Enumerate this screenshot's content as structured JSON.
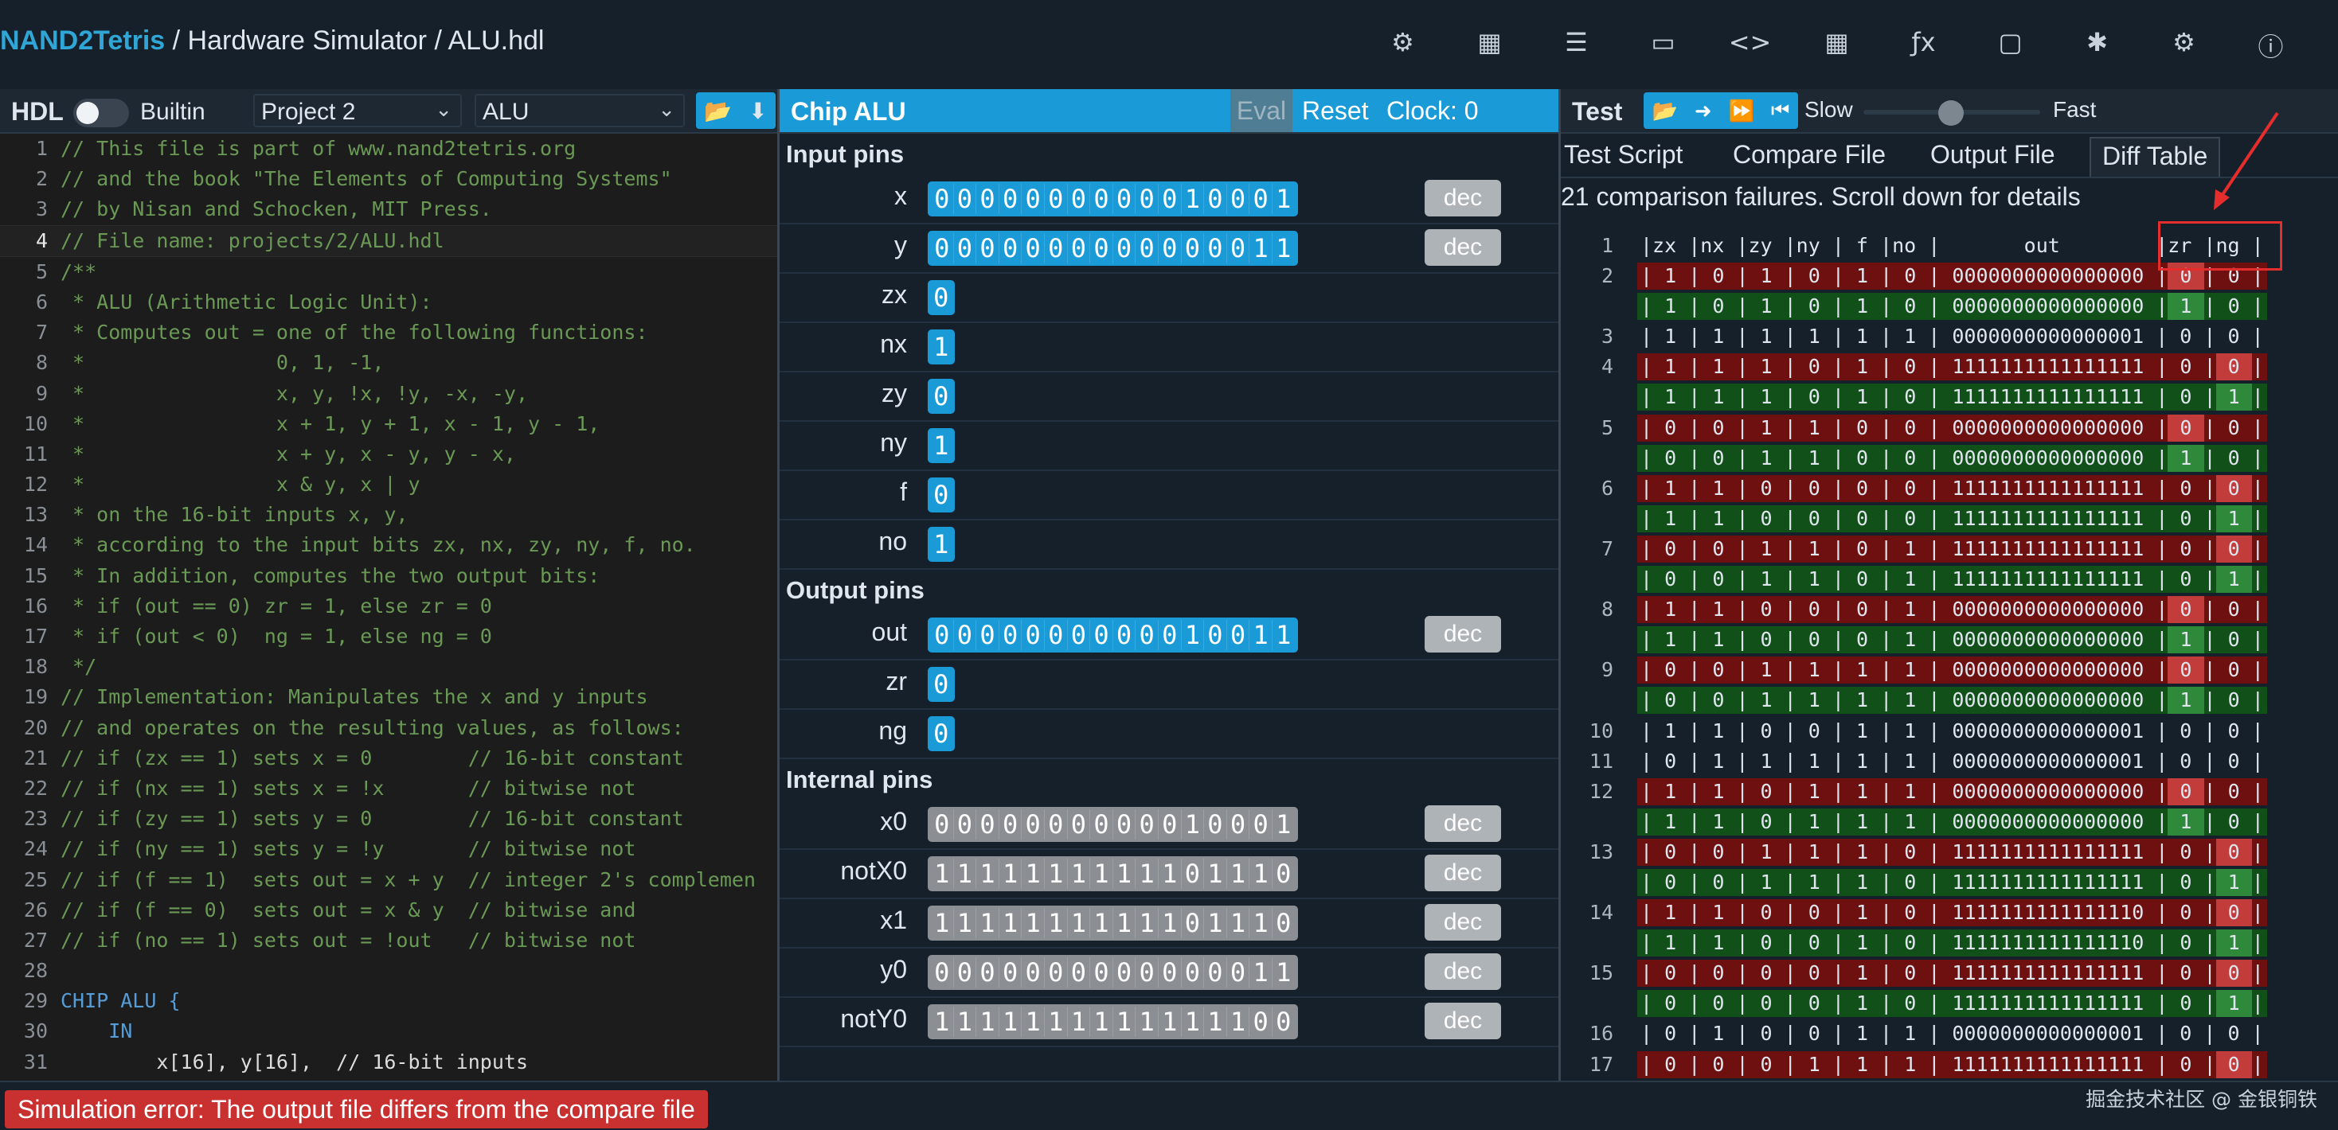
{
  "header": {
    "brand": "NAND2Tetris",
    "breadcrumb_sep1": "/",
    "breadcrumb_section": "Hardware Simulator",
    "breadcrumb_sep2": "/",
    "breadcrumb_file": "ALU.hdl",
    "icons": [
      "chip-icon",
      "cpu-icon",
      "list-icon",
      "monitor-icon",
      "code-icon",
      "grid-icon",
      "function-icon",
      "book-icon",
      "bug-icon",
      "settings-icon",
      "info-icon"
    ],
    "icon_glyphs": [
      "⚙",
      "▦",
      "☰",
      "▭",
      "<>",
      "▦",
      "ƒx",
      "▢",
      "✱",
      "⚙",
      "ⓘ"
    ]
  },
  "hdl_panel": {
    "title": "HDL",
    "builtin_label": "Builtin",
    "project_select": "Project 2",
    "chip_select": "ALU",
    "buttons": [
      "📂",
      "⬇"
    ],
    "lines": [
      {
        "n": "1",
        "t": "// This file is part of www.nand2tetris.org",
        "k": "ct"
      },
      {
        "n": "2",
        "t": "// and the book \"The Elements of Computing Systems\"",
        "k": "ct"
      },
      {
        "n": "3",
        "t": "// by Nisan and Schocken, MIT Press.",
        "k": "ct"
      },
      {
        "n": "4",
        "t": "// File name: projects/2/ALU.hdl",
        "k": "ct"
      },
      {
        "n": "5",
        "t": "/**",
        "k": "ct"
      },
      {
        "n": "6",
        "t": " * ALU (Arithmetic Logic Unit):",
        "k": "ct"
      },
      {
        "n": "7",
        "t": " * Computes out = one of the following functions:",
        "k": "ct"
      },
      {
        "n": "8",
        "t": " *                0, 1, -1,",
        "k": "ct"
      },
      {
        "n": "9",
        "t": " *                x, y, !x, !y, -x, -y,",
        "k": "ct"
      },
      {
        "n": "10",
        "t": " *                x + 1, y + 1, x - 1, y - 1,",
        "k": "ct"
      },
      {
        "n": "11",
        "t": " *                x + y, x - y, y - x,",
        "k": "ct"
      },
      {
        "n": "12",
        "t": " *                x & y, x | y",
        "k": "ct"
      },
      {
        "n": "13",
        "t": " * on the 16-bit inputs x, y,",
        "k": "ct"
      },
      {
        "n": "14",
        "t": " * according to the input bits zx, nx, zy, ny, f, no.",
        "k": "ct"
      },
      {
        "n": "15",
        "t": " * In addition, computes the two output bits:",
        "k": "ct"
      },
      {
        "n": "16",
        "t": " * if (out == 0) zr = 1, else zr = 0",
        "k": "ct"
      },
      {
        "n": "17",
        "t": " * if (out < 0)  ng = 1, else ng = 0",
        "k": "ct"
      },
      {
        "n": "18",
        "t": " */",
        "k": "ct"
      },
      {
        "n": "19",
        "t": "// Implementation: Manipulates the x and y inputs",
        "k": "ct"
      },
      {
        "n": "20",
        "t": "// and operates on the resulting values, as follows:",
        "k": "ct"
      },
      {
        "n": "21",
        "t": "// if (zx == 1) sets x = 0        // 16-bit constant",
        "k": "ct"
      },
      {
        "n": "22",
        "t": "// if (nx == 1) sets x = !x       // bitwise not",
        "k": "ct"
      },
      {
        "n": "23",
        "t": "// if (zy == 1) sets y = 0        // 16-bit constant",
        "k": "ct"
      },
      {
        "n": "24",
        "t": "// if (ny == 1) sets y = !y       // bitwise not",
        "k": "ct"
      },
      {
        "n": "25",
        "t": "// if (f == 1)  sets out = x + y  // integer 2's complemen",
        "k": "ct"
      },
      {
        "n": "26",
        "t": "// if (f == 0)  sets out = x & y  // bitwise and",
        "k": "ct"
      },
      {
        "n": "27",
        "t": "// if (no == 1) sets out = !out   // bitwise not",
        "k": "ct"
      },
      {
        "n": "28",
        "t": "",
        "k": "tx"
      },
      {
        "n": "29",
        "t": "CHIP ALU {",
        "k": "kw"
      },
      {
        "n": "30",
        "t": "    IN",
        "k": "kw"
      },
      {
        "n": "31",
        "t": "        x[16], y[16],  // 16-bit inputs",
        "k": "mix"
      }
    ]
  },
  "chip_panel": {
    "title": "Chip ALU",
    "eval_label": "Eval",
    "reset_label": "Reset",
    "clock_label": "Clock: 0",
    "dec_label": "dec",
    "input_section": "Input pins",
    "output_section": "Output pins",
    "internal_section": "Internal pins",
    "inputs": [
      {
        "name": "x",
        "bits": "0000000000010001"
      },
      {
        "name": "y",
        "bits": "0000000000000011"
      },
      {
        "name": "zx",
        "bits": "0"
      },
      {
        "name": "nx",
        "bits": "1"
      },
      {
        "name": "zy",
        "bits": "0"
      },
      {
        "name": "ny",
        "bits": "1"
      },
      {
        "name": "f",
        "bits": "0"
      },
      {
        "name": "no",
        "bits": "1"
      }
    ],
    "outputs": [
      {
        "name": "out",
        "bits": "0000000000010011"
      },
      {
        "name": "zr",
        "bits": "0"
      },
      {
        "name": "ng",
        "bits": "0"
      }
    ],
    "internals": [
      {
        "name": "x0",
        "bits": "0000000000010001"
      },
      {
        "name": "notX0",
        "bits": "1111111111101110"
      },
      {
        "name": "x1",
        "bits": "1111111111101110"
      },
      {
        "name": "y0",
        "bits": "0000000000000011"
      },
      {
        "name": "notY0",
        "bits": "1111111111111100"
      }
    ]
  },
  "test_panel": {
    "title": "Test",
    "buttons": [
      "📂",
      "➜",
      "⏩",
      "⏮"
    ],
    "slow_label": "Slow",
    "fast_label": "Fast",
    "speed": 0.55,
    "tabs": [
      "Test Script",
      "Compare File",
      "Output File",
      "Diff Table"
    ],
    "active_tab": "Diff Table",
    "failures_text": "21 comparison failures. Scroll down for details",
    "diff_rows": [
      {
        "n": "1",
        "s": "h",
        "t": "|zx |nx |zy |ny | f |no |       out        |zr |ng |"
      },
      {
        "n": "2",
        "s": "red",
        "t": "| 1 | 0 | 1 | 0 | 1 | 0 | 0000000000000000 | 0 | 0 |",
        "hl": "zr"
      },
      {
        "n": "",
        "s": "green",
        "t": "| 1 | 0 | 1 | 0 | 1 | 0 | 0000000000000000 | 1 | 0 |",
        "hl": "zr"
      },
      {
        "n": "3",
        "s": "",
        "t": "| 1 | 1 | 1 | 1 | 1 | 1 | 0000000000000001 | 0 | 0 |"
      },
      {
        "n": "4",
        "s": "red",
        "t": "| 1 | 1 | 1 | 0 | 1 | 0 | 1111111111111111 | 0 | 0 |",
        "hl": "ng"
      },
      {
        "n": "",
        "s": "green",
        "t": "| 1 | 1 | 1 | 0 | 1 | 0 | 1111111111111111 | 0 | 1 |",
        "hl": "ng"
      },
      {
        "n": "5",
        "s": "red",
        "t": "| 0 | 0 | 1 | 1 | 0 | 0 | 0000000000000000 | 0 | 0 |",
        "hl": "zr"
      },
      {
        "n": "",
        "s": "green",
        "t": "| 0 | 0 | 1 | 1 | 0 | 0 | 0000000000000000 | 1 | 0 |",
        "hl": "zr"
      },
      {
        "n": "6",
        "s": "red",
        "t": "| 1 | 1 | 0 | 0 | 0 | 0 | 1111111111111111 | 0 | 0 |",
        "hl": "ng"
      },
      {
        "n": "",
        "s": "green",
        "t": "| 1 | 1 | 0 | 0 | 0 | 0 | 1111111111111111 | 0 | 1 |",
        "hl": "ng"
      },
      {
        "n": "7",
        "s": "red",
        "t": "| 0 | 0 | 1 | 1 | 0 | 1 | 1111111111111111 | 0 | 0 |",
        "hl": "ng"
      },
      {
        "n": "",
        "s": "green",
        "t": "| 0 | 0 | 1 | 1 | 0 | 1 | 1111111111111111 | 0 | 1 |",
        "hl": "ng"
      },
      {
        "n": "8",
        "s": "red",
        "t": "| 1 | 1 | 0 | 0 | 0 | 1 | 0000000000000000 | 0 | 0 |",
        "hl": "zr"
      },
      {
        "n": "",
        "s": "green",
        "t": "| 1 | 1 | 0 | 0 | 0 | 1 | 0000000000000000 | 1 | 0 |",
        "hl": "zr"
      },
      {
        "n": "9",
        "s": "red",
        "t": "| 0 | 0 | 1 | 1 | 1 | 1 | 0000000000000000 | 0 | 0 |",
        "hl": "zr"
      },
      {
        "n": "",
        "s": "green",
        "t": "| 0 | 0 | 1 | 1 | 1 | 1 | 0000000000000000 | 1 | 0 |",
        "hl": "zr"
      },
      {
        "n": "10",
        "s": "",
        "t": "| 1 | 1 | 0 | 0 | 1 | 1 | 0000000000000001 | 0 | 0 |"
      },
      {
        "n": "11",
        "s": "",
        "t": "| 0 | 1 | 1 | 1 | 1 | 1 | 0000000000000001 | 0 | 0 |"
      },
      {
        "n": "12",
        "s": "red",
        "t": "| 1 | 1 | 0 | 1 | 1 | 1 | 0000000000000000 | 0 | 0 |",
        "hl": "zr"
      },
      {
        "n": "",
        "s": "green",
        "t": "| 1 | 1 | 0 | 1 | 1 | 1 | 0000000000000000 | 1 | 0 |",
        "hl": "zr"
      },
      {
        "n": "13",
        "s": "red",
        "t": "| 0 | 0 | 1 | 1 | 1 | 0 | 1111111111111111 | 0 | 0 |",
        "hl": "ng"
      },
      {
        "n": "",
        "s": "green",
        "t": "| 0 | 0 | 1 | 1 | 1 | 0 | 1111111111111111 | 0 | 1 |",
        "hl": "ng"
      },
      {
        "n": "14",
        "s": "red",
        "t": "| 1 | 1 | 0 | 0 | 1 | 0 | 1111111111111110 | 0 | 0 |",
        "hl": "ng"
      },
      {
        "n": "",
        "s": "green",
        "t": "| 1 | 1 | 0 | 0 | 1 | 0 | 1111111111111110 | 0 | 1 |",
        "hl": "ng"
      },
      {
        "n": "15",
        "s": "red",
        "t": "| 0 | 0 | 0 | 0 | 1 | 0 | 1111111111111111 | 0 | 0 |",
        "hl": "ng"
      },
      {
        "n": "",
        "s": "green",
        "t": "| 0 | 0 | 0 | 0 | 1 | 0 | 1111111111111111 | 0 | 1 |",
        "hl": "ng"
      },
      {
        "n": "16",
        "s": "",
        "t": "| 0 | 1 | 0 | 0 | 1 | 1 | 0000000000000001 | 0 | 0 |"
      },
      {
        "n": "17",
        "s": "red",
        "t": "| 0 | 0 | 0 | 1 | 1 | 1 | 1111111111111111 | 0 | 0 |",
        "hl": "ng"
      }
    ]
  },
  "status": {
    "error": "Simulation error: The output file differs from the compare file",
    "watermark": "掘金技术社区 @ 金银铜铁"
  }
}
